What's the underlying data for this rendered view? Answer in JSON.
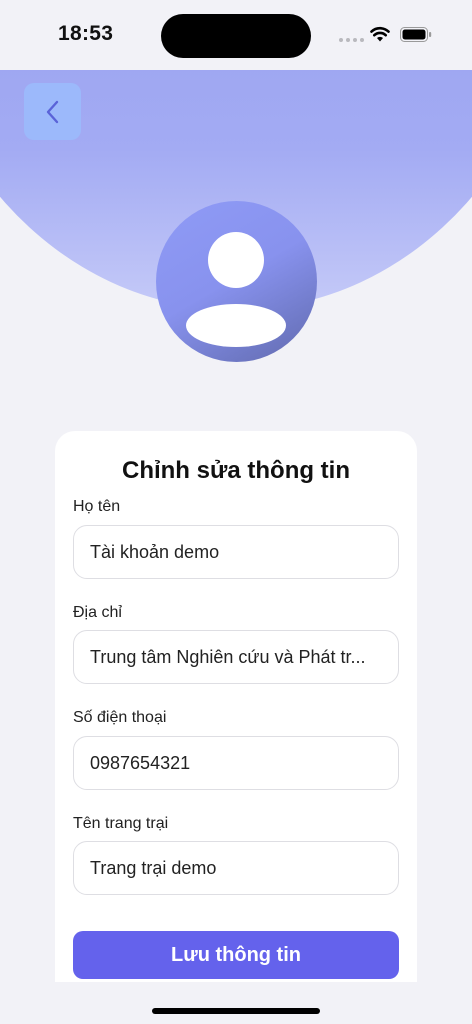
{
  "status_bar": {
    "time": "18:53",
    "icons": [
      "signal-dots-icon",
      "wifi-icon",
      "battery-icon"
    ]
  },
  "header": {
    "back_icon": "chevron-left-icon",
    "avatar_icon": "user-avatar-icon",
    "gradient_colors": [
      "#8690ee",
      "#c5caf8"
    ]
  },
  "form": {
    "title": "Chỉnh sửa thông tin",
    "fields": [
      {
        "label": "Họ tên",
        "value": "Tài khoản demo"
      },
      {
        "label": "Địa chỉ",
        "value": "Trung tâm Nghiên cứu và Phát tr..."
      },
      {
        "label": "Số điện thoại",
        "value": "0987654321"
      },
      {
        "label": "Tên trang trại",
        "value": "Trang trại demo"
      }
    ],
    "save_label": "Lưu thông tin"
  },
  "colors": {
    "primary_button": "#6462ec",
    "back_button": "#9cb9fb",
    "background": "#f2f2f7"
  }
}
